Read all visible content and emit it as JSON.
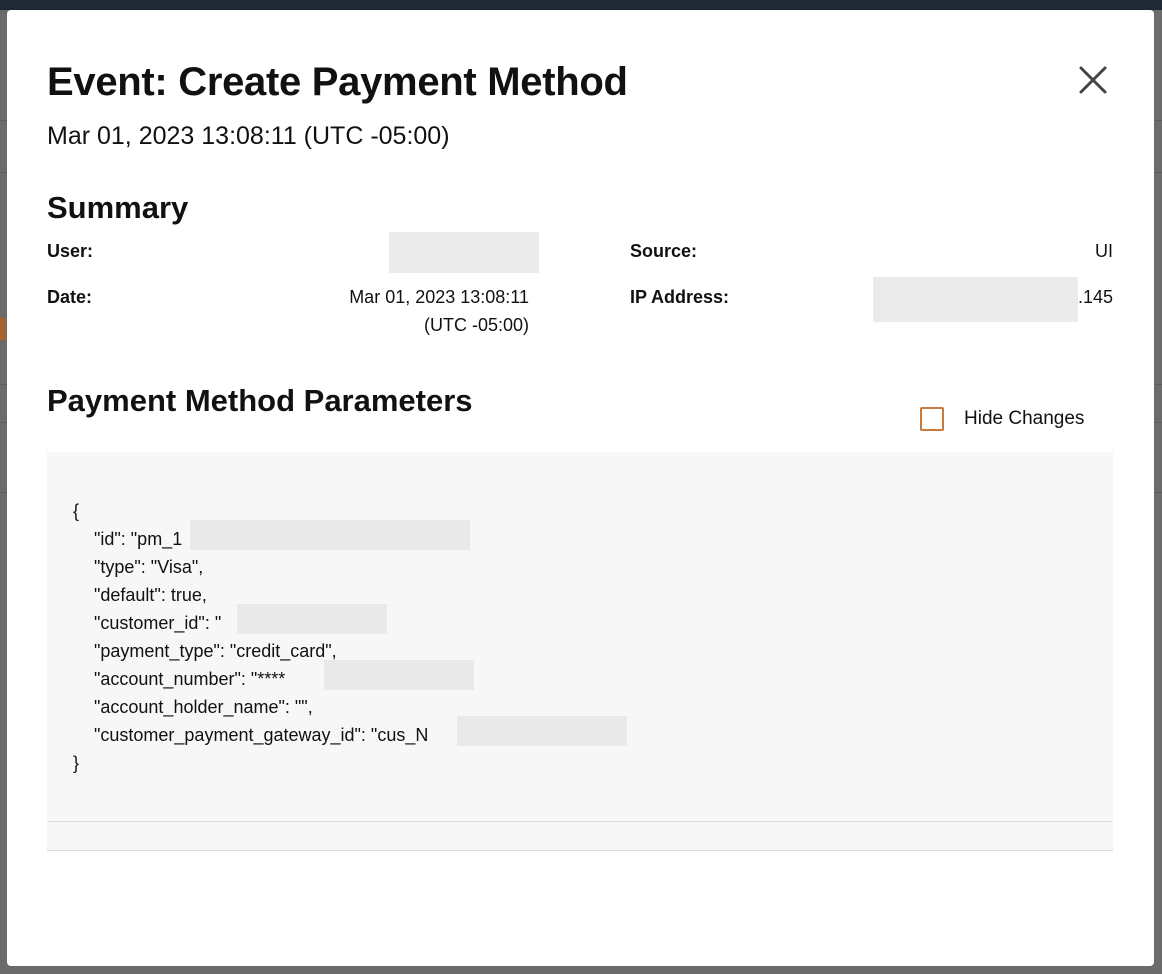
{
  "modal": {
    "title": "Event: Create Payment Method",
    "timestamp": "Mar 01, 2023 13:08:11 (UTC -05:00)",
    "close_icon": "close-icon"
  },
  "summary": {
    "heading": "Summary",
    "user_label": "User:",
    "source_label": "Source:",
    "source_value": "UI",
    "date_label": "Date:",
    "date_value_line1": "Mar 01, 2023 13:08:11",
    "date_value_line2": "(UTC -05:00)",
    "ip_label": "IP Address:",
    "ip_value_suffix": ".145"
  },
  "params": {
    "heading": "Payment Method Parameters",
    "hide_changes_label": "Hide Changes",
    "hide_changes_checked": false,
    "accent_color": "#c97a3c",
    "lines": {
      "open": "{",
      "id": "\"id\": \"pm_1",
      "type": "\"type\": \"Visa\",",
      "default": "\"default\": true,",
      "customer_id": "\"customer_id\": \"",
      "payment_type": "\"payment_type\": \"credit_card\",",
      "account_number": "\"account_number\": \"****",
      "account_holder_name": "\"account_holder_name\": \"\",",
      "gateway_id": "\"customer_payment_gateway_id\": \"cus_N",
      "close": "}"
    }
  }
}
